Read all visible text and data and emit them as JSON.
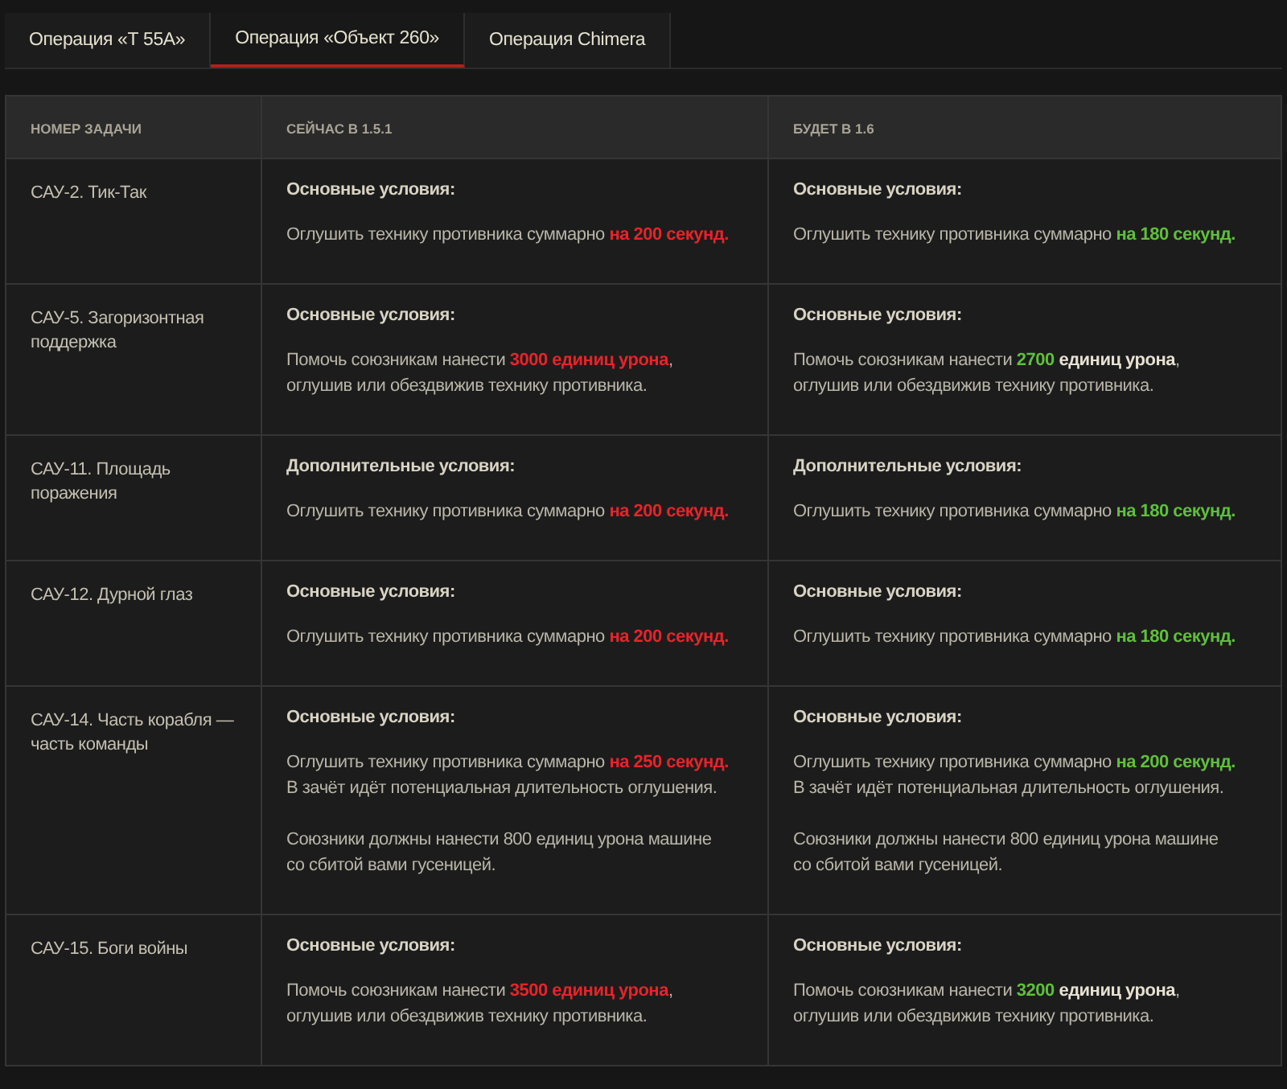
{
  "tabs": [
    {
      "label": "Операция «Т 55А»",
      "selected": false
    },
    {
      "label": "Операция «Объект 260»",
      "selected": true
    },
    {
      "label": "Операция Chimera",
      "selected": false
    }
  ],
  "table": {
    "columns": [
      "НОМЕР ЗАДАЧИ",
      "СЕЙЧАС В 1.5.1",
      "БУДЕТ В 1.6"
    ],
    "rows": [
      {
        "cells": [
          {
            "kind": "task",
            "text": "САУ-2. Тик-Так"
          },
          {
            "kind": "conditions",
            "heading": "Основные условия:",
            "paragraphs": [
              [
                [
                  {
                    "t": "Оглушить технику противника суммарно ",
                    "kind": "plain"
                  },
                  {
                    "t": "на 200 секунд.",
                    "kind": "worse"
                  }
                ]
              ]
            ]
          },
          {
            "kind": "conditions",
            "heading": "Основные условия:",
            "paragraphs": [
              [
                [
                  {
                    "t": "Оглушить технику противника суммарно ",
                    "kind": "plain"
                  },
                  {
                    "t": "на 180 секунд.",
                    "kind": "better"
                  }
                ]
              ]
            ]
          }
        ]
      },
      {
        "cells": [
          {
            "kind": "task",
            "text": "САУ-5. Загоризонтная поддержка"
          },
          {
            "kind": "conditions",
            "heading": "Основные условия:",
            "paragraphs": [
              [
                [
                  {
                    "t": "Помочь союзникам нанести ",
                    "kind": "plain"
                  },
                  {
                    "t": "3000 единиц урона",
                    "kind": "worse"
                  },
                  {
                    "t": ",",
                    "kind": "plain"
                  }
                ],
                [
                  {
                    "t": "оглушив или обездвижив технику противника.",
                    "kind": "plain"
                  }
                ]
              ]
            ]
          },
          {
            "kind": "conditions",
            "heading": "Основные условия:",
            "paragraphs": [
              [
                [
                  {
                    "t": "Помочь союзникам нанести ",
                    "kind": "plain"
                  },
                  {
                    "t": "2700",
                    "kind": "better"
                  },
                  {
                    "t": " единиц урона",
                    "kind": "bold"
                  },
                  {
                    "t": ",",
                    "kind": "plain"
                  }
                ],
                [
                  {
                    "t": "оглушив или обездвижив технику противника.",
                    "kind": "plain"
                  }
                ]
              ]
            ]
          }
        ]
      },
      {
        "cells": [
          {
            "kind": "task",
            "text": "САУ-11. Площадь поражения"
          },
          {
            "kind": "conditions",
            "heading": "Дополнительные условия:",
            "paragraphs": [
              [
                [
                  {
                    "t": "Оглушить технику противника суммарно ",
                    "kind": "plain"
                  },
                  {
                    "t": "на 200 секунд.",
                    "kind": "worse"
                  }
                ]
              ]
            ]
          },
          {
            "kind": "conditions",
            "heading": "Дополнительные условия:",
            "paragraphs": [
              [
                [
                  {
                    "t": "Оглушить технику противника суммарно ",
                    "kind": "plain"
                  },
                  {
                    "t": "на 180 секунд.",
                    "kind": "better"
                  }
                ]
              ]
            ]
          }
        ]
      },
      {
        "cells": [
          {
            "kind": "task",
            "text": "САУ-12. Дурной глаз"
          },
          {
            "kind": "conditions",
            "heading": "Основные условия:",
            "paragraphs": [
              [
                [
                  {
                    "t": "Оглушить технику противника суммарно ",
                    "kind": "plain"
                  },
                  {
                    "t": "на 200 секунд.",
                    "kind": "worse"
                  }
                ]
              ]
            ]
          },
          {
            "kind": "conditions",
            "heading": "Основные условия:",
            "paragraphs": [
              [
                [
                  {
                    "t": "Оглушить технику противника суммарно ",
                    "kind": "plain"
                  },
                  {
                    "t": "на 180 секунд.",
                    "kind": "better"
                  }
                ]
              ]
            ]
          }
        ]
      },
      {
        "cells": [
          {
            "kind": "task",
            "text": "САУ-14. Часть корабля — часть команды"
          },
          {
            "kind": "conditions",
            "heading": "Основные условия:",
            "paragraphs": [
              [
                [
                  {
                    "t": "Оглушить технику противника суммарно ",
                    "kind": "plain"
                  },
                  {
                    "t": "на 250 секунд.",
                    "kind": "worse"
                  }
                ],
                [
                  {
                    "t": "В зачёт идёт потенциальная длительность оглушения.",
                    "kind": "plain"
                  }
                ]
              ],
              [
                [
                  {
                    "t": "Союзники должны нанести 800 единиц урона машине",
                    "kind": "plain"
                  }
                ],
                [
                  {
                    "t": "со сбитой вами гусеницей.",
                    "kind": "plain"
                  }
                ]
              ]
            ]
          },
          {
            "kind": "conditions",
            "heading": "Основные условия:",
            "paragraphs": [
              [
                [
                  {
                    "t": "Оглушить технику противника суммарно ",
                    "kind": "plain"
                  },
                  {
                    "t": "на 200 секунд.",
                    "kind": "better"
                  }
                ],
                [
                  {
                    "t": "В зачёт идёт потенциальная длительность оглушения.",
                    "kind": "plain"
                  }
                ]
              ],
              [
                [
                  {
                    "t": "Союзники должны нанести 800 единиц урона машине",
                    "kind": "plain"
                  }
                ],
                [
                  {
                    "t": "со сбитой вами гусеницей.",
                    "kind": "plain"
                  }
                ]
              ]
            ]
          }
        ]
      },
      {
        "cells": [
          {
            "kind": "task",
            "text": "САУ-15. Боги войны"
          },
          {
            "kind": "conditions",
            "heading": "Основные условия:",
            "paragraphs": [
              [
                [
                  {
                    "t": "Помочь союзникам нанести ",
                    "kind": "plain"
                  },
                  {
                    "t": "3500 единиц урона",
                    "kind": "worse"
                  },
                  {
                    "t": ",",
                    "kind": "plain"
                  }
                ],
                [
                  {
                    "t": "оглушив или обездвижив технику противника.",
                    "kind": "plain"
                  }
                ]
              ]
            ]
          },
          {
            "kind": "conditions",
            "heading": "Основные условия:",
            "paragraphs": [
              [
                [
                  {
                    "t": "Помочь союзникам нанести ",
                    "kind": "plain"
                  },
                  {
                    "t": "3200",
                    "kind": "better"
                  },
                  {
                    "t": " единиц урона",
                    "kind": "bold"
                  },
                  {
                    "t": ",",
                    "kind": "plain"
                  }
                ],
                [
                  {
                    "t": "оглушив или обездвижив технику противника.",
                    "kind": "plain"
                  }
                ]
              ]
            ]
          }
        ]
      }
    ]
  }
}
